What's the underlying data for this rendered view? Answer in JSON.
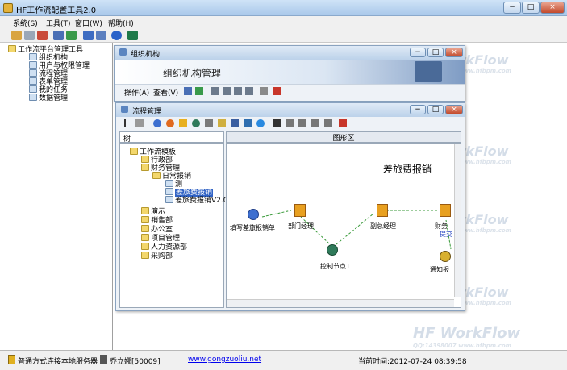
{
  "window": {
    "title": "HF工作流配置工具2.0",
    "controls": [
      "−",
      "□",
      "×"
    ]
  },
  "menubar": {
    "items": [
      "系统(S)",
      "工具(T)",
      "窗口(W)",
      "帮助(H)"
    ]
  },
  "left_tree": {
    "root": "工作流平台管理工具",
    "items": [
      "组织机构",
      "用户与权限管理",
      "流程管理",
      "表单管理",
      "我的任务",
      "数据管理"
    ]
  },
  "org_window": {
    "title": "组织机构",
    "banner": "组织机构管理",
    "menu": [
      "操作(A)",
      "查看(V)"
    ]
  },
  "flow_window": {
    "title": "流程管理",
    "tabs": [
      "树",
      "图形区"
    ],
    "tree": {
      "root": "工作流模板",
      "items": [
        {
          "label": "行政部",
          "level": 1
        },
        {
          "label": "财务管理",
          "level": 1
        },
        {
          "label": "日常报销",
          "level": 2
        },
        {
          "label": "测",
          "level": 3
        },
        {
          "label": "差旅费报销",
          "level": 3,
          "selected": true
        },
        {
          "label": "差旅费报销V2.0",
          "level": 3
        },
        {
          "label": "演示",
          "level": 1
        },
        {
          "label": "销售部",
          "level": 1
        },
        {
          "label": "办公室",
          "level": 1
        },
        {
          "label": "项目管理",
          "level": 1
        },
        {
          "label": "人力资源部",
          "level": 1
        },
        {
          "label": "采购部",
          "level": 1
        }
      ]
    },
    "diagram": {
      "title": "差旅费报销",
      "nodes": [
        "填写差旅报销单",
        "部门经理",
        "控制节点1",
        "副总经理",
        "财务",
        "提交",
        "通知报"
      ]
    }
  },
  "watermarks": {
    "brand": "HF WorkFlow",
    "sub": "QQ:14398007 www.hfbpm.com"
  },
  "statusbar": {
    "connection": "普通方式连接本地服务器",
    "user": "乔立娜[50009]",
    "website": "www.gongzuoliu.net",
    "time": "当前时间:2012-07-24 08:39:58"
  },
  "colors": {
    "titlebar": "#a9c8ea",
    "link": "#0000ee",
    "edge": "#3a9a3a"
  }
}
